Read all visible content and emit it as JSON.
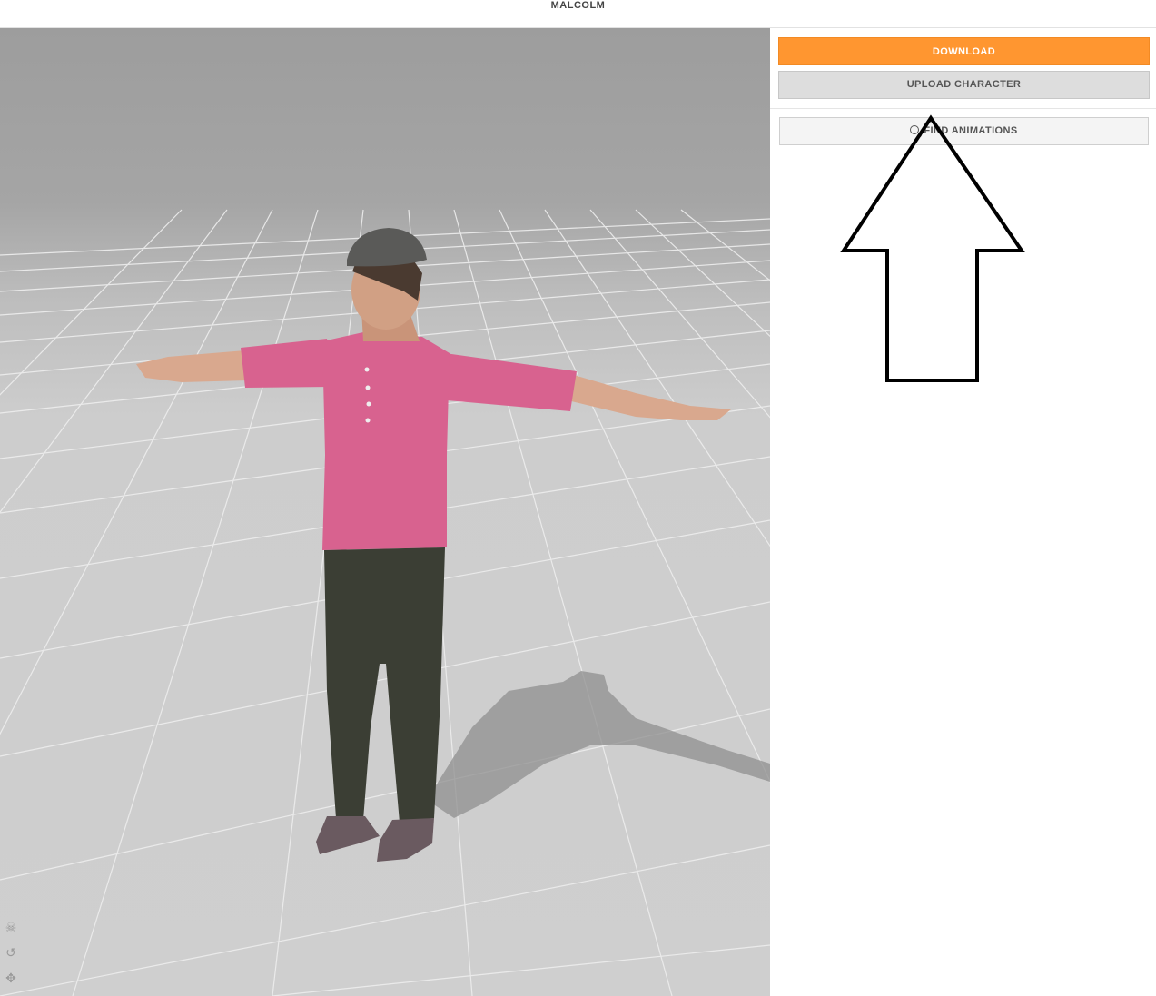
{
  "app": {
    "character_name": "MALCOLM"
  },
  "sidebar": {
    "download_label": "DOWNLOAD",
    "upload_label": "UPLOAD CHARACTER",
    "find_animations_label": "FIND ANIMATIONS",
    "find_animations_icon": "search-icon"
  },
  "viewport": {
    "tools": [
      "skeleton-icon",
      "reset-icon",
      "move-icon"
    ]
  },
  "colors": {
    "accent": "#ff9630",
    "shirt": "#d8628f",
    "floor": "#cfcfcf",
    "grid": "#ffffff"
  }
}
